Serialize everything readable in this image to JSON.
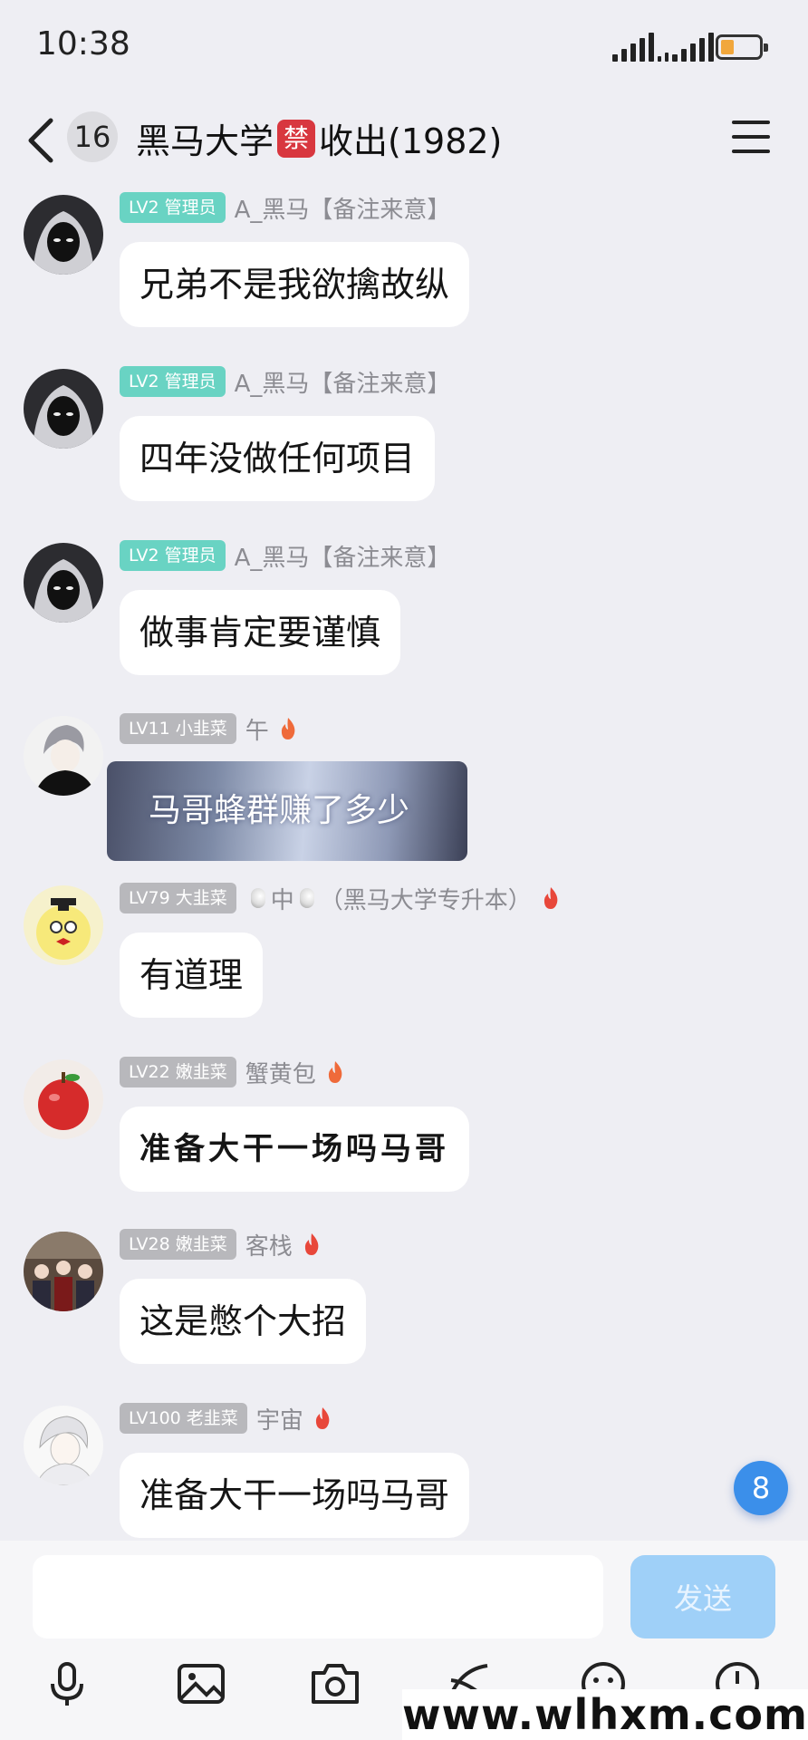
{
  "status_bar": {
    "time": "10:38"
  },
  "header": {
    "unread_count": "16",
    "group_name_part1": "黑马大学",
    "ban_badge": "禁",
    "group_name_part2": "收出(1982)"
  },
  "messages": [
    {
      "level": "LV2 管理员",
      "nick": "A_黑马【备注来意】",
      "text": "兄弟不是我欲擒故纵"
    },
    {
      "level": "LV2 管理员",
      "nick": "A_黑马【备注来意】",
      "text": "四年没做任何项目"
    },
    {
      "level": "LV2 管理员",
      "nick": "A_黑马【备注来意】",
      "text": "做事肯定要谨慎"
    },
    {
      "level": "LV11 小韭菜",
      "nick": "午",
      "text": "马哥蜂群赚了多少"
    },
    {
      "level": "LV79 大韭菜",
      "nick_center": "中",
      "nick_suffix": "（黑马大学专升本）",
      "text": "有道理"
    },
    {
      "level": "LV22 嫩韭菜",
      "nick": "蟹黄包",
      "text": "准备大干一场吗马哥"
    },
    {
      "level": "LV28 嫩韭菜",
      "nick": "客栈",
      "text": "这是憋个大招"
    },
    {
      "level": "LV100 老韭菜",
      "nick": "宇宙",
      "text": "准备大干一场吗马哥"
    }
  ],
  "floating_badge": "8",
  "input": {
    "value": "",
    "send_label": "发送"
  },
  "watermark": "www.wlhxm.com",
  "icons": [
    "back-icon",
    "menu-icon",
    "fire-icon",
    "mic-icon",
    "image-icon",
    "camera-icon",
    "gift-icon",
    "emoji-icon",
    "clock-icon"
  ],
  "colors": {
    "admin_tag": "#69d3c3",
    "member_tag": "#b8b8bc",
    "ban_badge": "#d8373f",
    "send_button": "#9fd0f8",
    "badge_blue": "#3b8fea"
  }
}
